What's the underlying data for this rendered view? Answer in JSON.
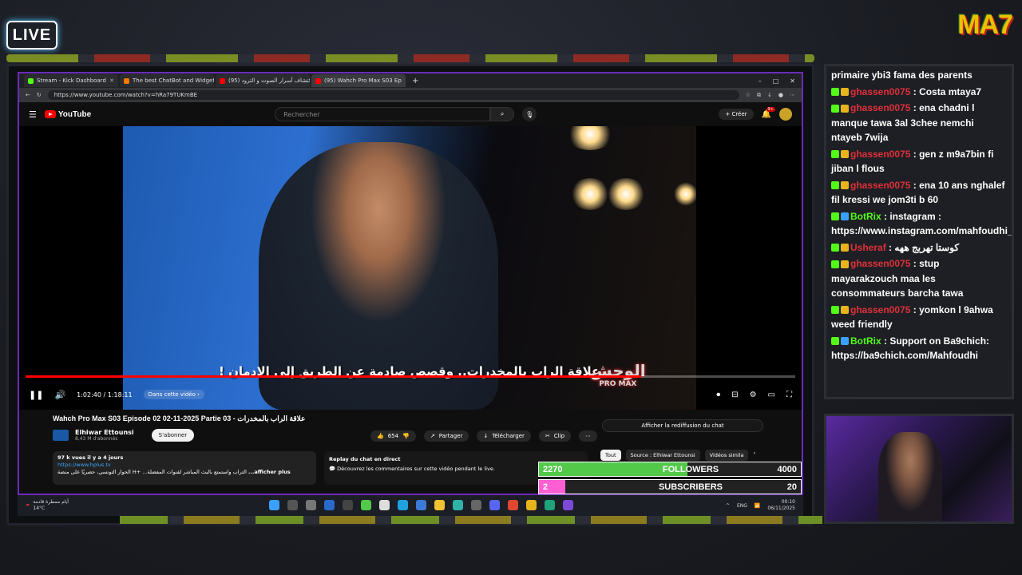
{
  "overlay": {
    "live_label": "LIVE",
    "brand": "MA7"
  },
  "browser": {
    "tabs": [
      {
        "label": "Stream - Kick Dashboard",
        "color": "#53fc18"
      },
      {
        "label": "The best ChatBot and Widgets fo",
        "color": "#ff7a00"
      },
      {
        "label": "(95) إكتشاف أسرار الصوت و الترود",
        "color": "#ff0000"
      },
      {
        "label": "(95) Wahch Pro Max S03 Ep",
        "color": "#ff0000"
      }
    ],
    "url": "https://www.youtube.com/watch?v=hRa79TUKmBE",
    "window_controls": [
      "–",
      "□",
      "✕"
    ]
  },
  "youtube": {
    "logo": "YouTube",
    "search_placeholder": "Rechercher",
    "create_label": "Créer",
    "notif_count": "9+",
    "player": {
      "subtitle": "علاقة الراب بالمخدرات.. وقصص صادمة عن الطريق إلى الإدمان !",
      "show_logo": "الوحش",
      "show_logo_sub": "PRO MAX",
      "time_current": "1:02:40",
      "time_total": "1:18:11",
      "progress": 0.8,
      "chapter": "Dans cette vidéo"
    },
    "video": {
      "title": "Wahch Pro Max S03 Episode 02 02-11-2025 Partie 03 - علاقة الراب بالمخدرات",
      "channel": "Elhiwar Ettounsi",
      "subs": "8,43 M d'abonnés",
      "subscribe": "S'abonner",
      "likes": "654",
      "share": "Partager",
      "download": "Télécharger",
      "clip": "Clip",
      "views": "97 k vues  il y a 4 jours",
      "link": "https://www.hplus.tv",
      "desc": "الحوار التونسي، حصريًا على منصة H+ ...التراب واستمتع بالبث المباشر لقنوات المفضلة",
      "more": "...afficher plus",
      "replay_title": "Replay du chat en direct",
      "replay_text": "Découvrez les commentaires sur cette vidéo pendant le live.",
      "replay_button": "Afficher la rediffusion du chat",
      "chips": [
        "Tout",
        "Source : Elhiwar Ettounsi",
        "Vidéos simila"
      ]
    }
  },
  "taskbar": {
    "weather": "أيام ممطرة قادمة",
    "temp": "14°C",
    "lang": "ENG",
    "time": "00:10",
    "date": "06/11/2025"
  },
  "goals": {
    "followers": {
      "label": "FOLLOWERS",
      "current": "2270",
      "target": "4000",
      "fraction": 0.5675,
      "color": "#53c94a"
    },
    "subscribers": {
      "label": "SUBSCRIBERS",
      "current": "2",
      "target": "20",
      "fraction": 0.1,
      "color": "#ff5fd2"
    }
  },
  "chat": [
    {
      "user": "",
      "text": "primaire ybi3 fama des parents",
      "color": "#ffffff"
    },
    {
      "user": "ghassen0075",
      "text": "Costa mtaya7",
      "color": "#e0303a"
    },
    {
      "user": "ghassen0075",
      "text": "ena chadni l manque tawa 3al 3chee nemchi ntayeb 7wija",
      "color": "#e0303a"
    },
    {
      "user": "ghassen0075",
      "text": "gen z m9a7bin fi jiban l flous",
      "color": "#e0303a"
    },
    {
      "user": "ghassen0075",
      "text": "ena 10 ans nghalef fil kressi we jom3ti b 60",
      "color": "#e0303a"
    },
    {
      "user": "BotRix",
      "text": "instagram : https://www.instagram.com/mahfoudhi_tn/",
      "color": "#53fc18"
    },
    {
      "user": "Usheraf",
      "text": "كوستا تهريج ههه",
      "color": "#e0303a"
    },
    {
      "user": "ghassen0075",
      "text": "stup mayarakzouch maa les consommateurs barcha tawa",
      "color": "#e0303a"
    },
    {
      "user": "ghassen0075",
      "text": "yomkon l 9ahwa weed friendly",
      "color": "#e0303a"
    },
    {
      "user": "BotRix",
      "text": "Support on Ba9chich: https://ba9chich.com/Mahfoudhi",
      "color": "#53fc18"
    }
  ]
}
